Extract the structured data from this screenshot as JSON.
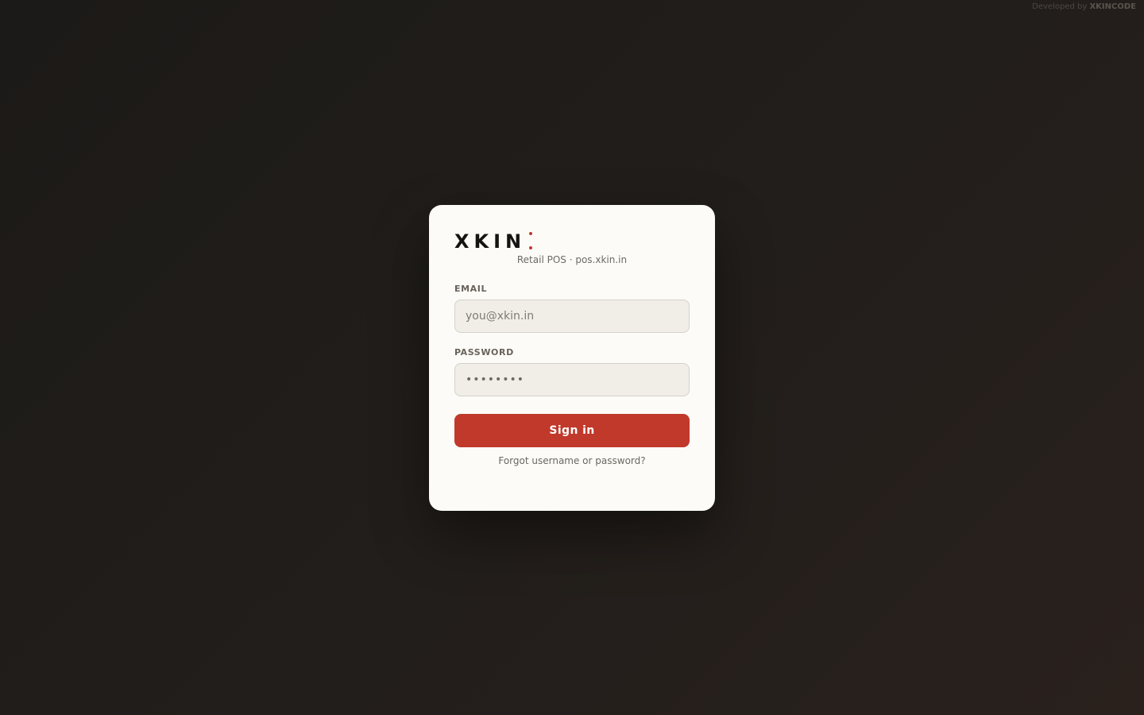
{
  "credit": {
    "prefix": "Developed by",
    "brand": "XKINCODE"
  },
  "logo": {
    "text": "XKIN",
    "accent_color": "#c0392b"
  },
  "tagline": "Retail POS · pos.xkin.in",
  "form": {
    "email_label": "EMAIL",
    "email_placeholder": "you@xkin.in",
    "email_value": "",
    "password_label": "PASSWORD",
    "password_masked": "••••••••",
    "submit_label": "Sign in",
    "forgot_link": "Forgot username or password?"
  },
  "colors": {
    "background": "#1e1b19",
    "card": "#fcfbf7",
    "accent": "#c0392b"
  }
}
